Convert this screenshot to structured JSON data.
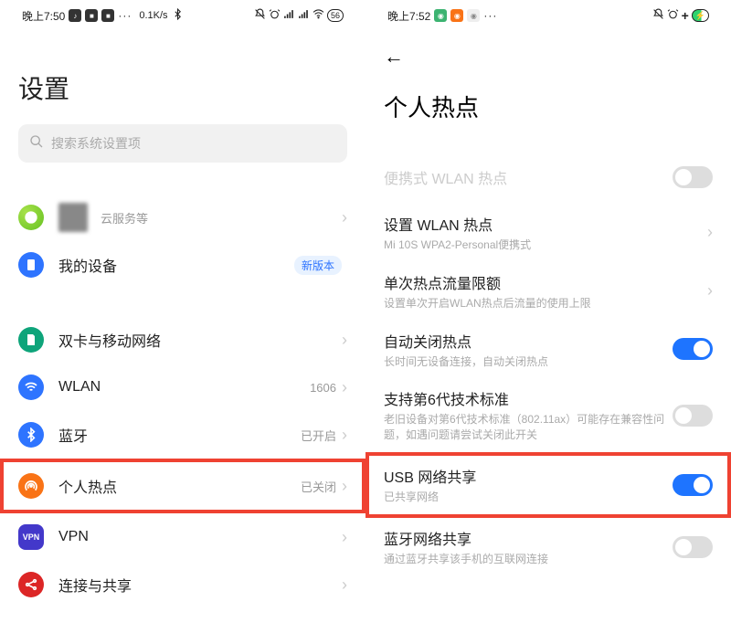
{
  "left": {
    "status": {
      "time": "晚上7:50",
      "speed": "0.1K/s",
      "batt": "56"
    },
    "title": "设置",
    "search_placeholder": "搜索系统设置项",
    "account_sub": "云服务等",
    "items": {
      "mydevice": {
        "label": "我的设备",
        "badge": "新版本"
      },
      "sim": {
        "label": "双卡与移动网络"
      },
      "wlan": {
        "label": "WLAN",
        "trail": "1606"
      },
      "bt": {
        "label": "蓝牙",
        "trail": "已开启"
      },
      "hotspot": {
        "label": "个人热点",
        "trail": "已关闭"
      },
      "vpn": {
        "label": "VPN"
      },
      "share": {
        "label": "连接与共享"
      }
    }
  },
  "right": {
    "status": {
      "time": "晚上7:52"
    },
    "title": "个人热点",
    "items": {
      "portable": {
        "title": "便携式 WLAN 热点"
      },
      "setwlan": {
        "title": "设置 WLAN 热点",
        "sub": "Mi 10S WPA2-Personal便携式"
      },
      "quota": {
        "title": "单次热点流量限额",
        "sub": "设置单次开启WLAN热点后流量的使用上限"
      },
      "autooff": {
        "title": "自动关闭热点",
        "sub": "长时间无设备连接，自动关闭热点"
      },
      "wifi6": {
        "title": "支持第6代技术标准",
        "sub": "老旧设备对第6代技术标准（802.11ax）可能存在兼容性问题，如遇问题请尝试关闭此开关"
      },
      "usb": {
        "title": "USB 网络共享",
        "sub": "已共享网络"
      },
      "btshare": {
        "title": "蓝牙网络共享",
        "sub": "通过蓝牙共享该手机的互联网连接"
      }
    }
  }
}
